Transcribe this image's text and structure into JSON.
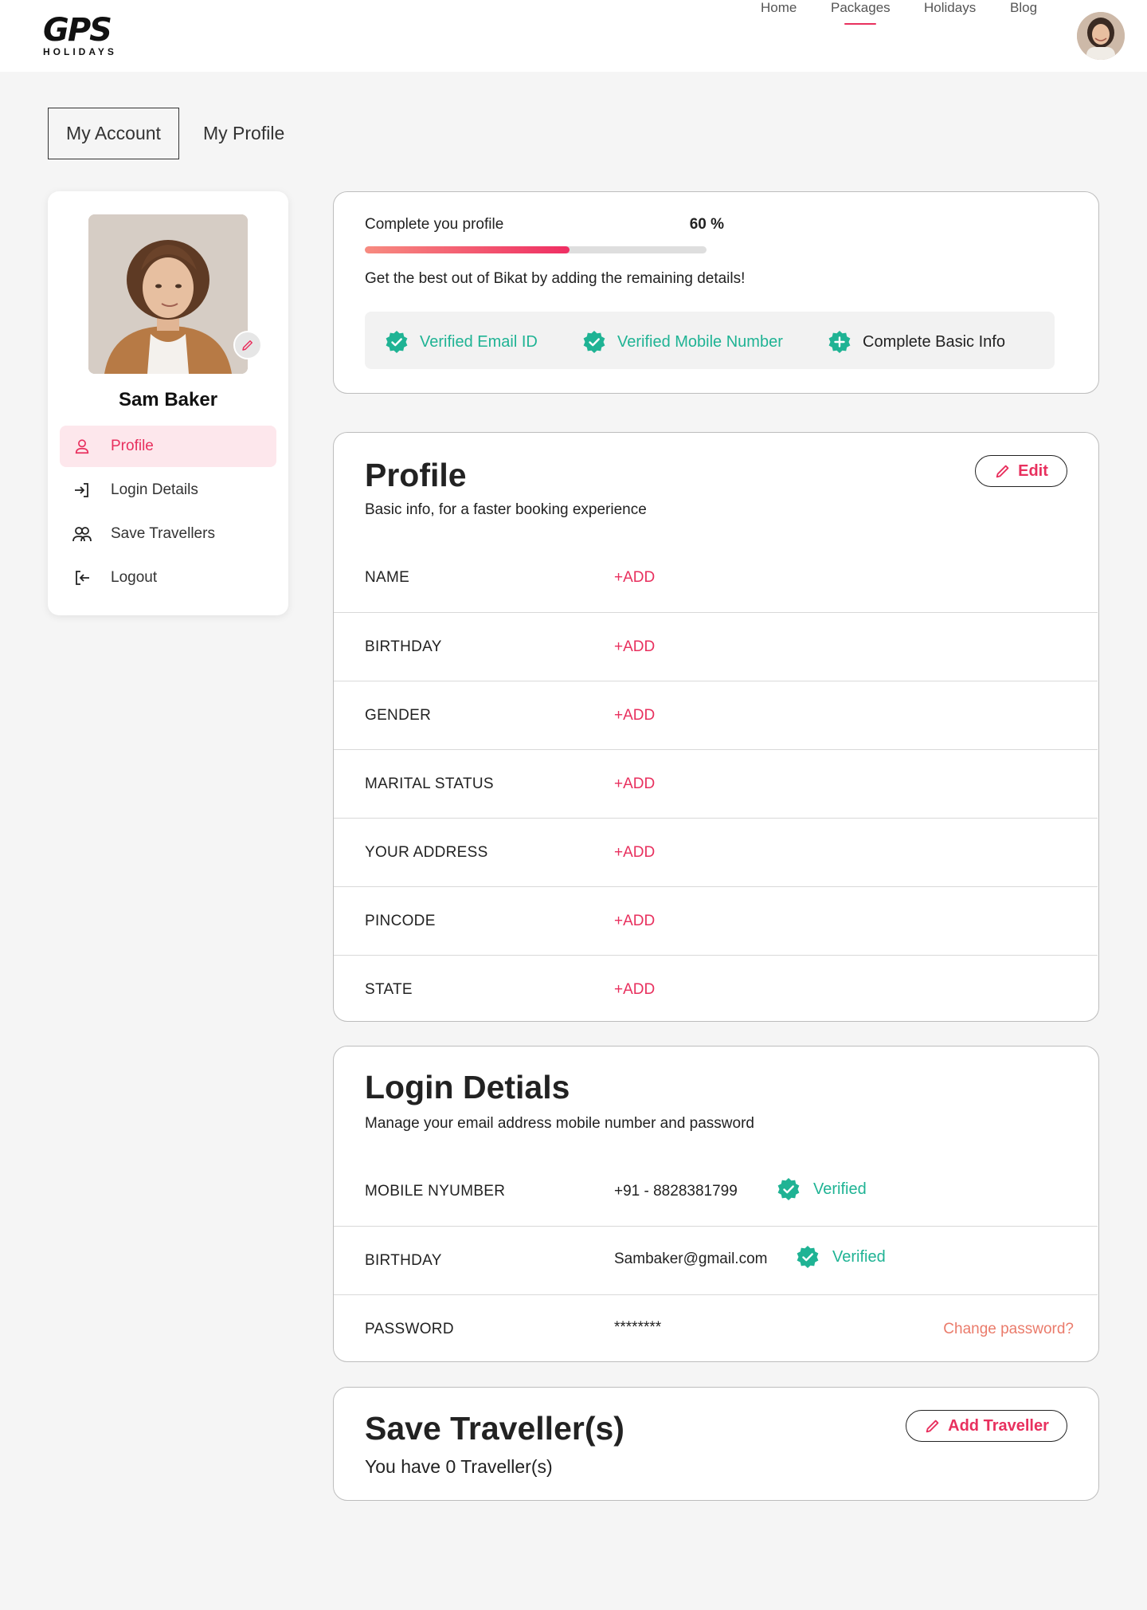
{
  "header": {
    "logo_main": "GPS",
    "logo_sub": "HOLIDAYS",
    "nav": [
      "Home",
      "Packages",
      "Holidays",
      "Blog"
    ],
    "active_nav": "Packages"
  },
  "tabs": {
    "account": "My Account",
    "profile": "My Profile"
  },
  "sidebar": {
    "user_name": "Sam Baker",
    "items": [
      {
        "label": "Profile",
        "icon": "user-icon",
        "active": true
      },
      {
        "label": "Login Details",
        "icon": "login-icon",
        "active": false
      },
      {
        "label": "Save Travellers",
        "icon": "users-icon",
        "active": false
      },
      {
        "label": "Logout",
        "icon": "logout-icon",
        "active": false
      }
    ]
  },
  "progress": {
    "label": "Complete you profile",
    "percent_text": "60 %",
    "percent": 60,
    "description": "Get the best out of Bikat by adding the remaining details!",
    "badges": [
      {
        "label": "Verified Email ID",
        "state": "verified"
      },
      {
        "label": "Verified Mobile Number",
        "state": "verified"
      },
      {
        "label": "Complete Basic Info",
        "state": "pending"
      }
    ]
  },
  "profile": {
    "title": "Profile",
    "subtitle": "Basic info, for a faster booking experience",
    "edit_label": "Edit",
    "fields": [
      {
        "label": "NAME",
        "value": "+ADD"
      },
      {
        "label": "BIRTHDAY",
        "value": "+ADD"
      },
      {
        "label": "GENDER",
        "value": "+ADD"
      },
      {
        "label": "MARITAL STATUS",
        "value": "+ADD"
      },
      {
        "label": "YOUR ADDRESS",
        "value": "+ADD"
      },
      {
        "label": "PINCODE",
        "value": "+ADD"
      },
      {
        "label": "STATE",
        "value": "+ADD"
      }
    ]
  },
  "login": {
    "title": "Login Detials",
    "subtitle": "Manage your email address mobile number and password",
    "mobile_label": "MOBILE NYUMBER",
    "mobile_value": "+91 - 8828381799",
    "mobile_status": "Verified",
    "email_label": "BIRTHDAY",
    "email_value": "Sambaker@gmail.com",
    "email_status": "Verified",
    "password_label": "PASSWORD",
    "password_value": "********",
    "change_password": "Change password?"
  },
  "travellers": {
    "title": "Save Traveller(s)",
    "subtitle": "You have 0 Traveller(s)",
    "add_label": "Add Traveller"
  },
  "colors": {
    "accent": "#e8305e",
    "verified": "#1fb394",
    "background": "#f5f5f5"
  }
}
